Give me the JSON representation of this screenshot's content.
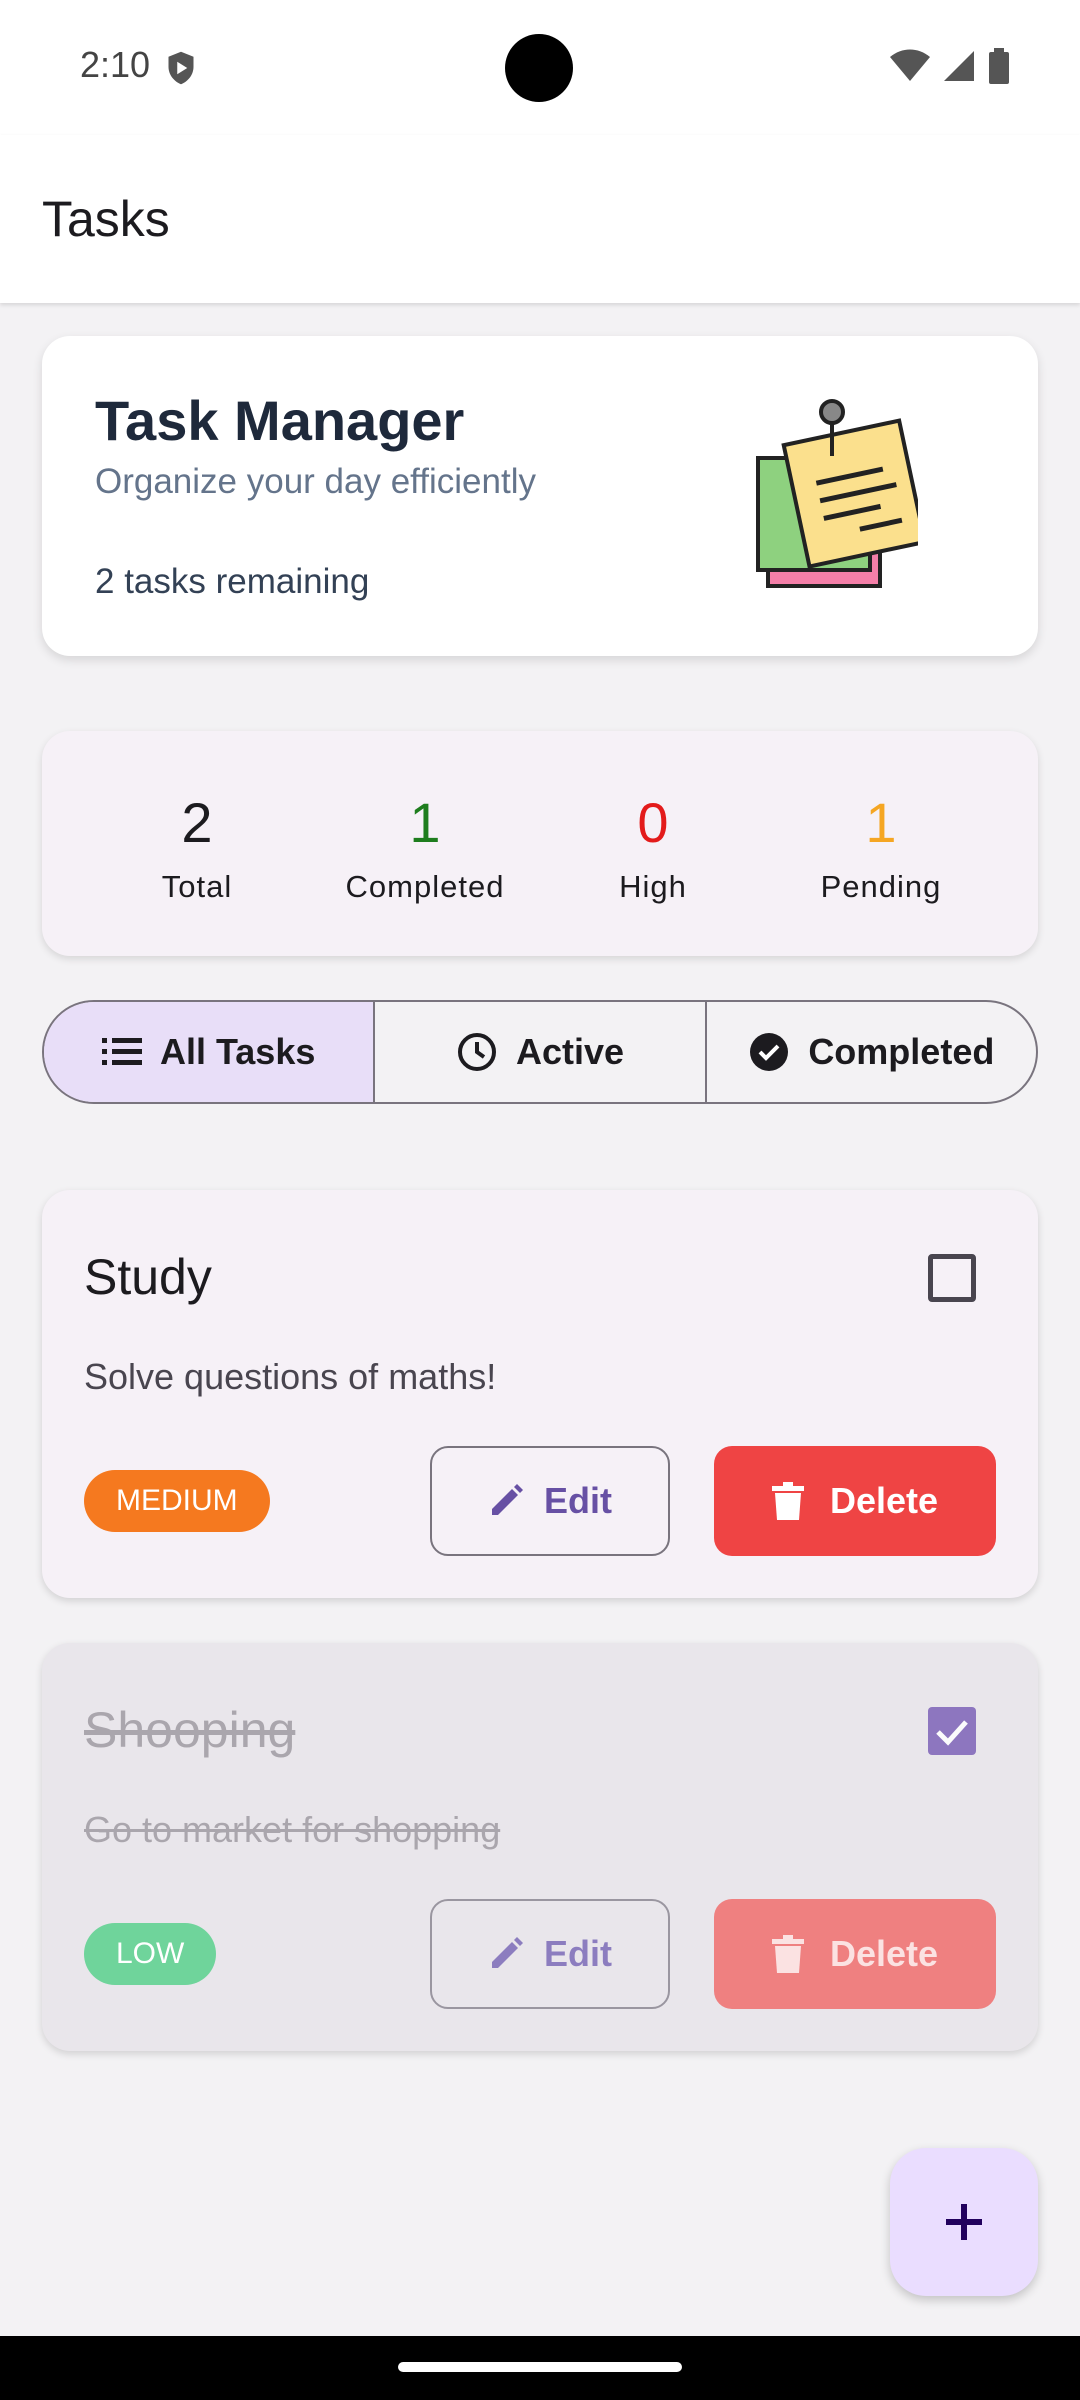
{
  "status_bar": {
    "time": "2:10"
  },
  "app_bar": {
    "title": "Tasks"
  },
  "header_card": {
    "title": "Task Manager",
    "subtitle": "Organize your day efficiently",
    "remaining": "2 tasks remaining",
    "illustration": "sticky-notes-icon"
  },
  "stats": [
    {
      "value": "2",
      "label": "Total",
      "color": "#1c1b1f"
    },
    {
      "value": "1",
      "label": "Completed",
      "color": "#1e7d1e"
    },
    {
      "value": "0",
      "label": "High",
      "color": "#e31b1b"
    },
    {
      "value": "1",
      "label": "Pending",
      "color": "#f5a623"
    }
  ],
  "filters": [
    {
      "label": "All Tasks",
      "icon": "list-icon",
      "selected": true
    },
    {
      "label": "Active",
      "icon": "clock-icon",
      "selected": false
    },
    {
      "label": "Completed",
      "icon": "check-circle-icon",
      "selected": false
    }
  ],
  "tasks": [
    {
      "title": "Study",
      "description": "Solve questions of maths!",
      "priority": "MEDIUM",
      "completed": false,
      "edit_label": "Edit",
      "delete_label": "Delete"
    },
    {
      "title": "Shooping",
      "description": "Go to market for shopping",
      "priority": "LOW",
      "completed": true,
      "edit_label": "Edit",
      "delete_label": "Delete"
    }
  ],
  "fab": {
    "icon": "plus-icon"
  },
  "colors": {
    "primary": "#6750a4",
    "delete": "#ef4444",
    "medium": "#f5791f",
    "low": "#6fd49b"
  }
}
